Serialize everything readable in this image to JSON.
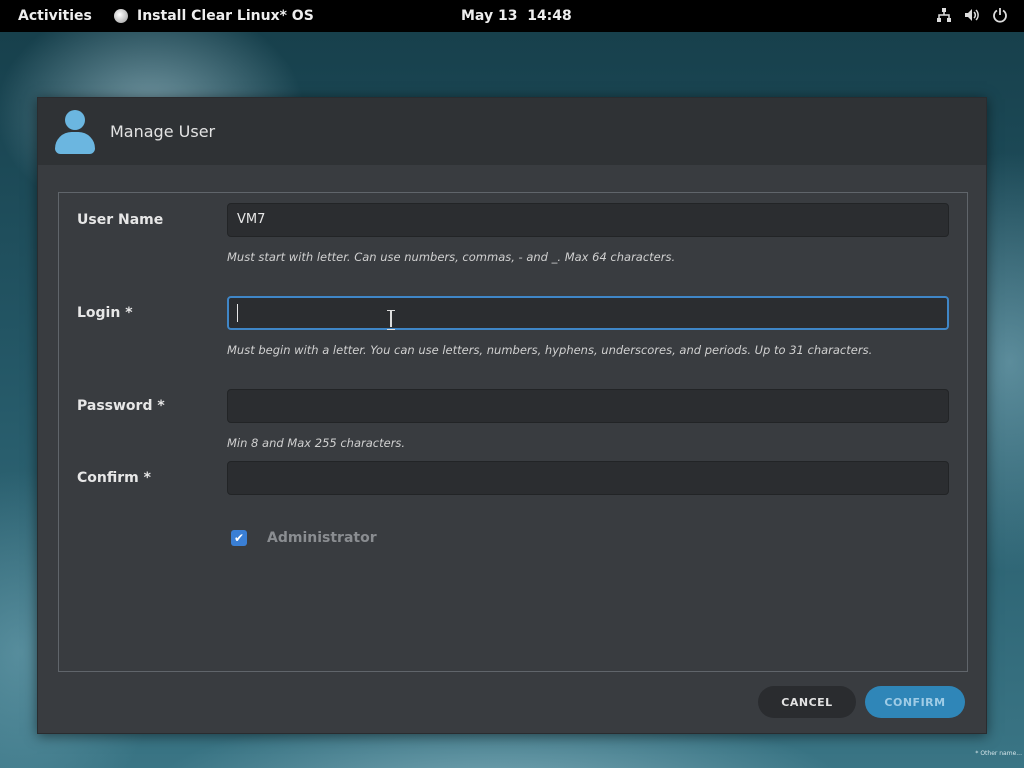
{
  "topbar": {
    "activities": "Activities",
    "app_title": "Install Clear Linux* OS",
    "date": "May 13",
    "time": "14:48",
    "tray_icons": [
      "network-icon",
      "volume-icon",
      "power-icon"
    ]
  },
  "dialog": {
    "title": "Manage User",
    "icon": "user-icon",
    "accent_color": "#6bb6e0",
    "fields": {
      "username": {
        "label": "User Name",
        "value": "VM7",
        "hint": "Must start with letter. Can use numbers, commas, - and _. Max 64 characters."
      },
      "login": {
        "label": "Login *",
        "value": "",
        "hint": "Must begin with a letter. You can use letters, numbers, hyphens, underscores, and periods. Up to 31 characters."
      },
      "password": {
        "label": "Password *",
        "value": "",
        "hint": "Min 8 and Max 255 characters."
      },
      "confirm": {
        "label": "Confirm *",
        "value": ""
      }
    },
    "administrator": {
      "label": "Administrator",
      "checked": true,
      "check_glyph": "✔"
    },
    "buttons": {
      "cancel": "CANCEL",
      "confirm": "CONFIRM"
    },
    "colors": {
      "focus": "#3f86c7",
      "checkbox": "#3a7fd5",
      "confirm_button": "#2f86b8"
    }
  },
  "desktop": {
    "footnote": "* Other name..."
  }
}
